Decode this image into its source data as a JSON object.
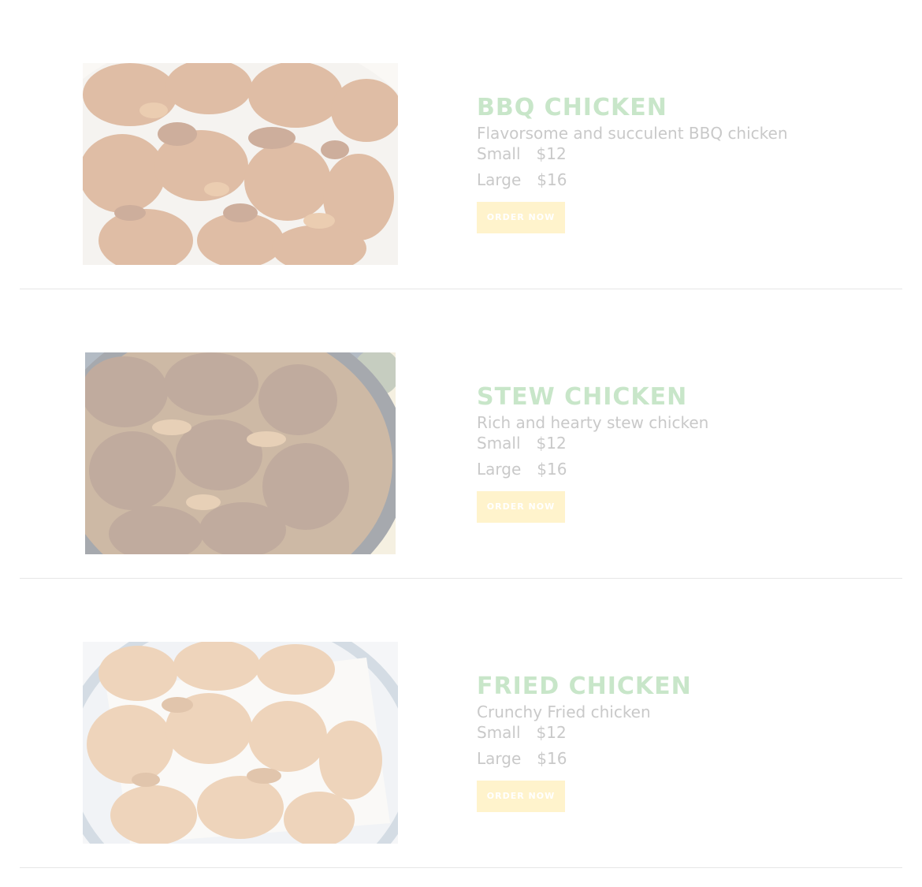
{
  "colors": {
    "title": "#c8e6c9",
    "text": "#c9c9c9",
    "button_bg": "#fff3cc",
    "button_text": "#ffffff",
    "divider": "#e6e6e6"
  },
  "items": [
    {
      "title": "BBQ CHICKEN",
      "description": "Flavorsome and succulent BBQ chicken",
      "prices": [
        {
          "size": "Small",
          "amount": "$12"
        },
        {
          "size": "Large",
          "amount": "$16"
        }
      ],
      "button": "ORDER NOW",
      "image": "bbq-chicken-photo"
    },
    {
      "title": "STEW CHICKEN",
      "description": "Rich and hearty stew chicken",
      "prices": [
        {
          "size": "Small",
          "amount": "$12"
        },
        {
          "size": "Large",
          "amount": "$16"
        }
      ],
      "button": "ORDER NOW",
      "image": "stew-chicken-photo"
    },
    {
      "title": "FRIED CHICKEN",
      "description": "Crunchy Fried chicken",
      "prices": [
        {
          "size": "Small",
          "amount": "$12"
        },
        {
          "size": "Large",
          "amount": "$16"
        }
      ],
      "button": "ORDER NOW",
      "image": "fried-chicken-photo"
    }
  ]
}
